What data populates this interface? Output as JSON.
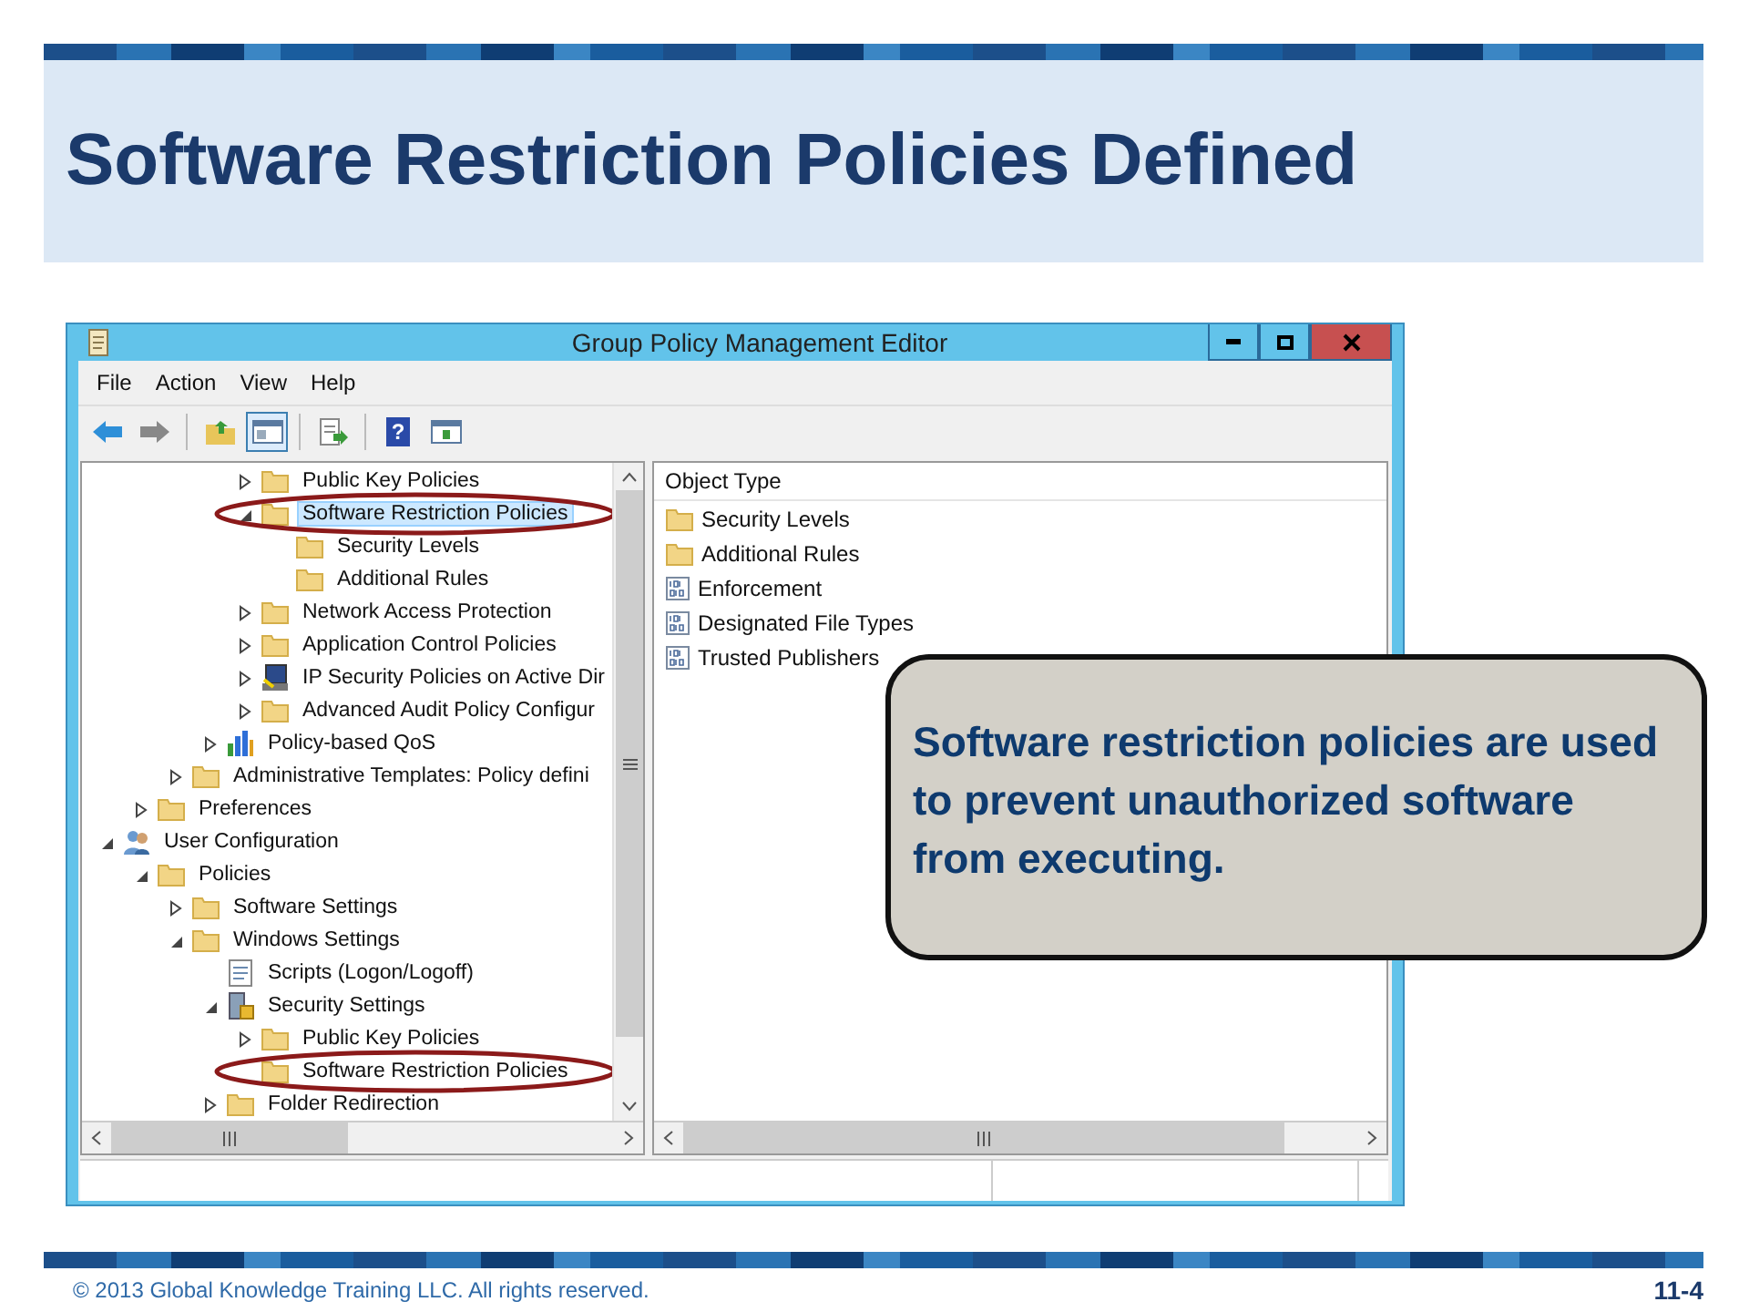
{
  "slide": {
    "title": "Software Restriction Policies Defined",
    "footer": "© 2013 Global Knowledge Training LLC. All rights reserved.",
    "page": "11-4"
  },
  "window": {
    "title": "Group Policy Management Editor"
  },
  "menu": [
    "File",
    "Action",
    "View",
    "Help"
  ],
  "toolbar": [
    [
      {
        "kind": "back",
        "pressed": false
      },
      {
        "kind": "forward",
        "pressed": false
      }
    ],
    [
      {
        "kind": "up",
        "pressed": false
      },
      {
        "kind": "tree",
        "pressed": true
      }
    ],
    [
      {
        "kind": "export",
        "pressed": false
      }
    ],
    [
      {
        "kind": "help",
        "label": "?",
        "pressed": false
      },
      {
        "kind": "pane",
        "pressed": false
      }
    ]
  ],
  "tree": [
    {
      "children": [
        {
          "children": [
            {
              "children": [
                {
                  "children": [
                    {
                      "label": "Public Key Policies",
                      "kind": "folder",
                      "expanded": false,
                      "selected": false,
                      "circled": false
                    },
                    {
                      "label": "Software Restriction Policies",
                      "kind": "folder",
                      "expanded": true,
                      "selected": true,
                      "circled": true,
                      "children": [
                        {
                          "label": "Security Levels",
                          "kind": "folder",
                          "selected": false,
                          "circled": false
                        },
                        {
                          "label": "Additional Rules",
                          "kind": "folder",
                          "selected": false,
                          "circled": false
                        }
                      ]
                    },
                    {
                      "label": "Network Access Protection",
                      "kind": "folder",
                      "expanded": false,
                      "selected": false,
                      "circled": false
                    },
                    {
                      "label": "Application Control Policies",
                      "kind": "folder",
                      "expanded": false,
                      "selected": false,
                      "circled": false
                    },
                    {
                      "label": "IP Security Policies on Active Dir",
                      "kind": "computer",
                      "expanded": false,
                      "selected": false,
                      "circled": false
                    },
                    {
                      "label": "Advanced Audit Policy Configur",
                      "kind": "folder",
                      "expanded": false,
                      "selected": false,
                      "circled": false
                    }
                  ]
                },
                {
                  "label": "Policy-based QoS",
                  "kind": "chart",
                  "expanded": false,
                  "selected": false,
                  "circled": false
                }
              ]
            },
            {
              "label": "Administrative Templates: Policy defini",
              "kind": "folder",
              "expanded": false,
              "selected": false,
              "circled": false
            }
          ]
        },
        {
          "label": "Preferences",
          "kind": "folder",
          "expanded": false,
          "selected": false,
          "circled": false
        }
      ]
    },
    {
      "label": "User Configuration",
      "kind": "user",
      "expanded": true,
      "selected": false,
      "circled": false,
      "children": [
        {
          "label": "Policies",
          "kind": "folder",
          "expanded": true,
          "selected": false,
          "circled": false,
          "children": [
            {
              "label": "Software Settings",
              "kind": "folder",
              "expanded": false,
              "selected": false,
              "circled": false
            },
            {
              "label": "Windows Settings",
              "kind": "folder",
              "expanded": true,
              "selected": false,
              "circled": false,
              "children": [
                {
                  "label": "Scripts (Logon/Logoff)",
                  "kind": "script",
                  "selected": false,
                  "circled": false
                },
                {
                  "label": "Security Settings",
                  "kind": "security",
                  "expanded": true,
                  "selected": false,
                  "circled": false,
                  "children": [
                    {
                      "label": "Public Key Policies",
                      "kind": "folder",
                      "expanded": false,
                      "selected": false,
                      "circled": false
                    },
                    {
                      "label": "Software Restriction Policies",
                      "kind": "folder",
                      "selected": false,
                      "circled": true
                    }
                  ]
                },
                {
                  "label": "Folder Redirection",
                  "kind": "folder",
                  "expanded": false,
                  "selected": false,
                  "circled": false
                }
              ]
            }
          ]
        }
      ]
    }
  ],
  "list": {
    "column": "Object Type",
    "items": [
      {
        "label": "Security Levels",
        "kind": "folder"
      },
      {
        "label": "Additional Rules",
        "kind": "folder"
      },
      {
        "label": "Enforcement",
        "kind": "binary"
      },
      {
        "label": "Designated File Types",
        "kind": "binary"
      },
      {
        "label": "Trusted Publishers",
        "kind": "binary"
      }
    ]
  },
  "callout": {
    "text": "Software restriction policies are used to prevent unauthorized software from executing."
  }
}
